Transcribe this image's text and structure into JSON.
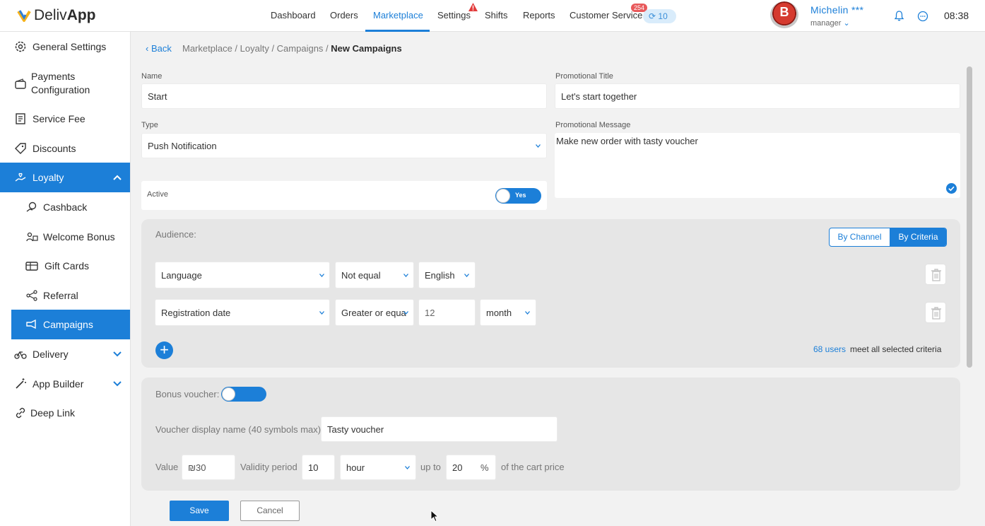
{
  "app": {
    "brand_prefix": "Deliv",
    "brand_suffix": "App"
  },
  "nav": {
    "items": [
      "Dashboard",
      "Orders",
      "Marketplace",
      "Settings",
      "Shifts",
      "Reports",
      "Customer Service"
    ],
    "active": "Marketplace",
    "notification_badge": "254",
    "cycle_count": "10"
  },
  "user": {
    "avatar_letter": "B",
    "name": "Michelin ***",
    "role": "manager",
    "time": "08:38"
  },
  "sidebar": {
    "items": [
      {
        "label": "General Settings",
        "icon": "gear-icon"
      },
      {
        "label": "Payments Configuration",
        "icon": "wallet-icon"
      },
      {
        "label": "Service Fee",
        "icon": "receipt-icon"
      },
      {
        "label": "Discounts",
        "icon": "tag-icon"
      },
      {
        "label": "Loyalty",
        "icon": "hand-heart-icon"
      },
      {
        "label": "Cashback",
        "icon": "cashback-icon"
      },
      {
        "label": "Welcome Bonus",
        "icon": "welcome-icon"
      },
      {
        "label": "Gift Cards",
        "icon": "gift-card-icon"
      },
      {
        "label": "Referral",
        "icon": "share-icon"
      },
      {
        "label": "Campaigns",
        "icon": "megaphone-icon"
      },
      {
        "label": "Delivery",
        "icon": "bike-icon"
      },
      {
        "label": "App Builder",
        "icon": "wand-icon"
      },
      {
        "label": "Deep Link",
        "icon": "link-icon"
      }
    ]
  },
  "breadcrumb": {
    "back": "Back",
    "path": "Marketplace / Loyalty / Campaigns / ",
    "current": "New Campaigns"
  },
  "form": {
    "name_label": "Name",
    "name_value": "Start",
    "type_label": "Type",
    "type_value": "Push Notification",
    "active_label": "Active",
    "active_toggle": "Yes",
    "promo_title_label": "Promotional Title",
    "promo_title_value": "Let's start together",
    "promo_message_label": "Promotional Message",
    "promo_message_value": "Make new order with tasty voucher"
  },
  "audience": {
    "label": "Audience:",
    "by_channel": "By Channel",
    "by_criteria": "By Criteria",
    "rows": [
      {
        "field": "Language",
        "operator": "Not equal",
        "value": "English"
      },
      {
        "field": "Registration date",
        "operator": "Greater or equa",
        "value": "12",
        "unit": "month"
      }
    ],
    "users_count": "68 users",
    "users_text": "meet all selected criteria"
  },
  "voucher": {
    "bonus_label": "Bonus voucher:",
    "display_name_label": "Voucher display name (40 symbols max):",
    "display_name_value": "Tasty voucher",
    "value_label": "Value",
    "value": "₪30",
    "validity_label": "Validity period",
    "validity_value": "10",
    "validity_unit": "hour",
    "upto_label": "up to",
    "percent_value": "20",
    "percent_sign": "%",
    "cart_label": "of the cart price"
  },
  "actions": {
    "save": "Save",
    "cancel": "Cancel"
  },
  "colors": {
    "accent": "#1c7fd8",
    "badge": "#e8595b",
    "panel": "#e6e6e6"
  }
}
